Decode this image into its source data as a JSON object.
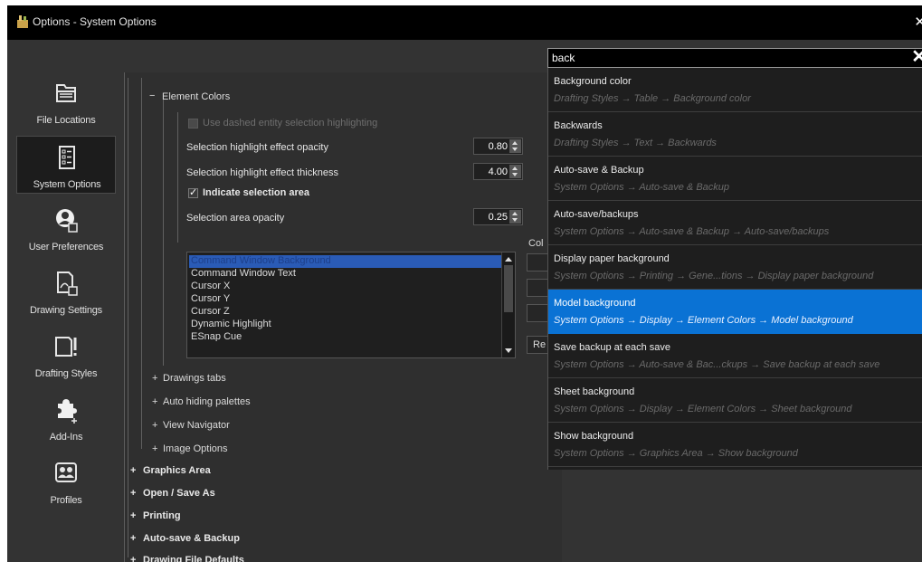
{
  "window": {
    "title": "Options - System Options"
  },
  "sidebar": {
    "items": [
      {
        "label": "File Locations",
        "icon": "folder-icon"
      },
      {
        "label": "System Options",
        "icon": "list-icon",
        "active": true
      },
      {
        "label": "User Preferences",
        "icon": "user-icon"
      },
      {
        "label": "Drawing Settings",
        "icon": "drawing-icon"
      },
      {
        "label": "Drafting Styles",
        "icon": "styles-icon"
      },
      {
        "label": "Add-Ins",
        "icon": "puzzle-icon"
      },
      {
        "label": "Profiles",
        "icon": "profiles-icon"
      }
    ]
  },
  "tree": {
    "element_colors": "Element Colors",
    "dashed": "Use dashed entity selection highlighting",
    "opacity_label": "Selection highlight effect opacity",
    "opacity_value": "0.80",
    "thickness_label": "Selection highlight effect thickness",
    "thickness_value": "4.00",
    "indicate_area": "Indicate selection area",
    "area_opacity_label": "Selection area opacity",
    "area_opacity_value": "0.25",
    "color_list": [
      "Command Window Background",
      "Command Window Text",
      "Cursor X",
      "Cursor Y",
      "Cursor Z",
      "Dynamic Highlight",
      "ESnap Cue"
    ],
    "color_label_partial": "Col",
    "reset_partial": "Re",
    "subsections": [
      "Drawings tabs",
      "Auto hiding palettes",
      "View Navigator",
      "Image Options"
    ],
    "sections": [
      "Graphics Area",
      "Open / Save As",
      "Printing",
      "Auto-save & Backup",
      "Drawing File Defaults"
    ],
    "expand": "+",
    "collapse": "−"
  },
  "search": {
    "value": "back",
    "results": [
      {
        "title": "Background color",
        "path": "Drafting Styles → Table → Background color"
      },
      {
        "title": "Backwards",
        "path": "Drafting Styles → Text → Backwards"
      },
      {
        "title": "Auto-save & Backup",
        "path": "System Options → Auto-save & Backup"
      },
      {
        "title": "Auto-save/backups",
        "path": "System Options → Auto-save & Backup → Auto-save/backups"
      },
      {
        "title": "Display paper background",
        "path": "System Options → Printing → Gene...tions → Display paper background"
      },
      {
        "title": "Model background",
        "path": "System Options → Display → Element Colors → Model background",
        "selected": true
      },
      {
        "title": "Save backup at each save",
        "path": "System Options → Auto-save & Bac...ckups → Save backup at each save"
      },
      {
        "title": "Sheet background",
        "path": "System Options → Display → Element Colors → Sheet background"
      },
      {
        "title": "Show background",
        "path": "System Options → Graphics Area → Show background"
      }
    ]
  },
  "colors": {
    "accent": "#0a72d4",
    "list_selection": "#2a5bb6",
    "background": "#333333"
  }
}
